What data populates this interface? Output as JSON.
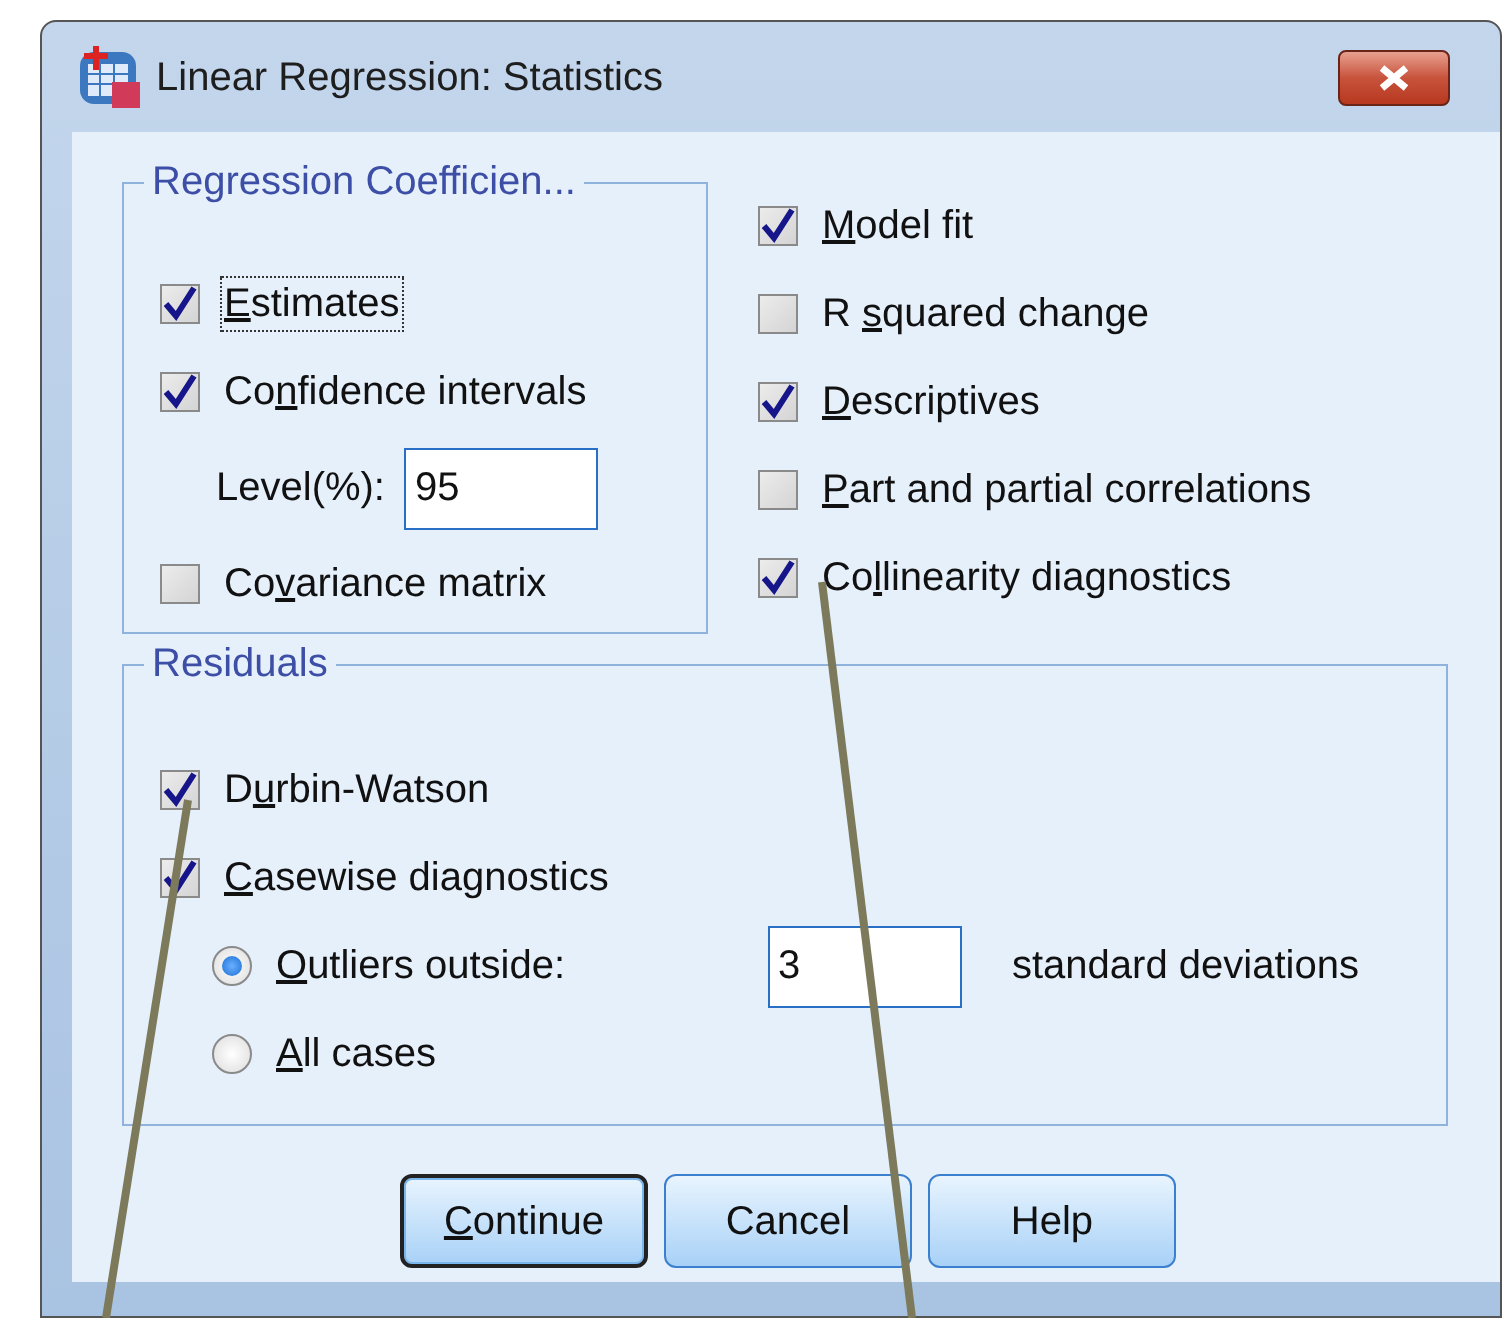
{
  "window": {
    "title": "Linear Regression: Statistics"
  },
  "regression_coefficients": {
    "title": "Regression Coefficien...",
    "items": [
      {
        "kind": "checkbox",
        "key": "E",
        "post": "stimates",
        "checked": true,
        "focused": true
      },
      {
        "kind": "checkbox",
        "pre": "Co",
        "key": "n",
        "post": "fidence intervals",
        "checked": true,
        "focused": false
      },
      {
        "kind": "field",
        "label": "Level(%):",
        "value": "95"
      },
      {
        "kind": "checkbox",
        "pre": "Co",
        "key": "v",
        "post": "ariance matrix",
        "checked": false,
        "focused": false
      }
    ]
  },
  "options": [
    {
      "key": "M",
      "post": "odel fit",
      "checked": true
    },
    {
      "pre": "R ",
      "key": "s",
      "post": "quared change",
      "checked": false
    },
    {
      "key": "D",
      "post": "escriptives",
      "checked": true
    },
    {
      "key": "P",
      "post": "art and partial correlations",
      "checked": false
    },
    {
      "pre": "Co",
      "key": "l",
      "post": "linearity diagnostics",
      "checked": true
    }
  ],
  "residuals": {
    "title": "Residuals",
    "items": [
      {
        "kind": "checkbox",
        "pre": "D",
        "key": "u",
        "post": "rbin-Watson",
        "checked": true
      },
      {
        "kind": "checkbox",
        "key": "C",
        "post": "asewise diagnostics",
        "checked": true
      },
      {
        "kind": "radio",
        "key": "O",
        "post": "utliers outside:",
        "selected": true,
        "value": "3",
        "suffix": "standard deviations"
      },
      {
        "kind": "radio",
        "key": "A",
        "post": "ll cases",
        "selected": false
      }
    ]
  },
  "buttons": [
    {
      "key": "C",
      "post": "ontinue",
      "default": true
    },
    {
      "post": "Cancel",
      "default": false
    },
    {
      "post": "Help",
      "default": false
    }
  ]
}
